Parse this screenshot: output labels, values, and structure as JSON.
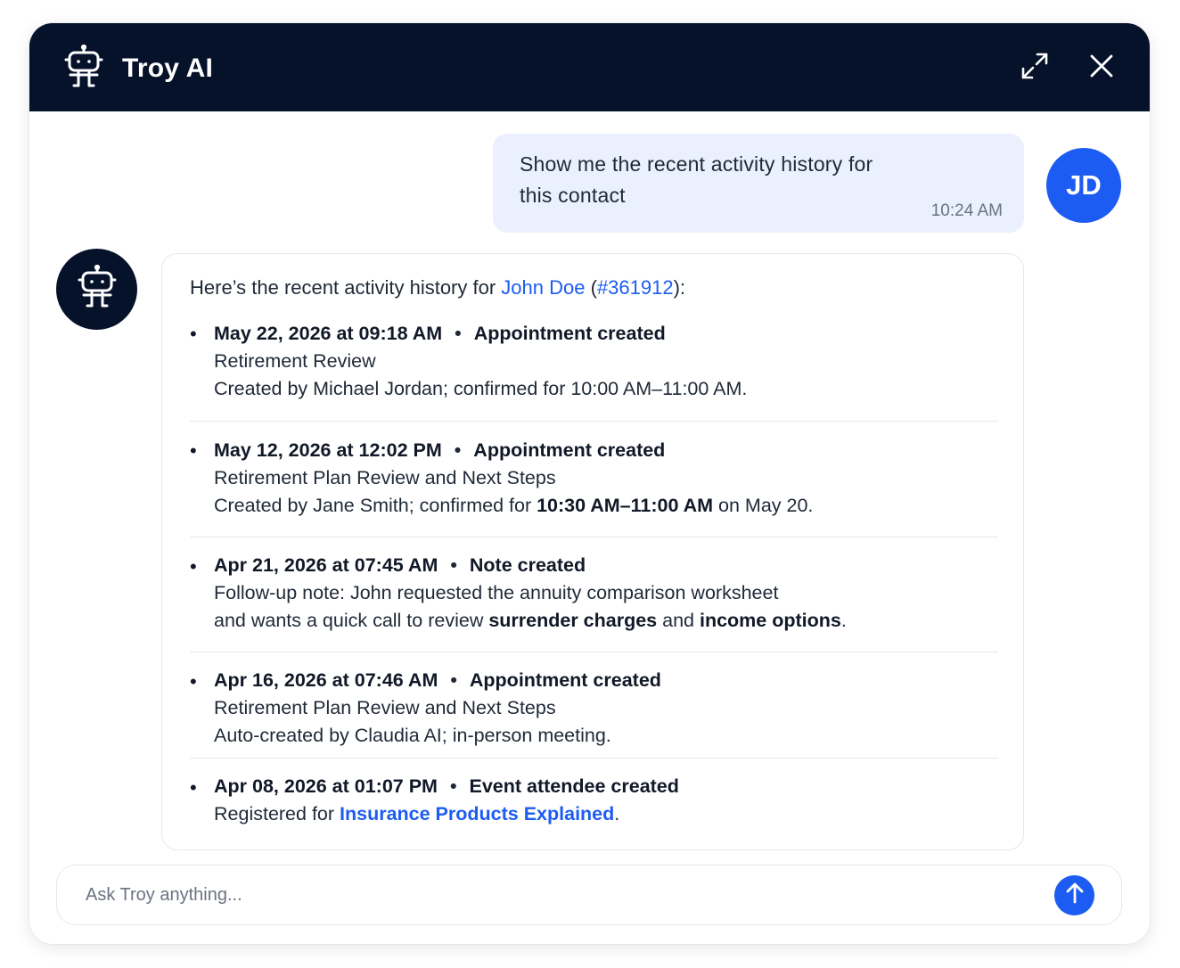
{
  "header": {
    "title": "Troy AI",
    "logo_icon": "robot-icon",
    "expand_icon": "expand-icon",
    "close_icon": "close-icon",
    "background": "#06112a"
  },
  "user_message": {
    "text": "Show me the recent activity history for this contact",
    "time": "10:24 AM",
    "avatar_initials": "JD",
    "avatar_color": "#1d5cf2"
  },
  "bot_message": {
    "intro_prefix": "Here’s the recent activity history for ",
    "contact_name": "John Doe",
    "intro_open": " (",
    "contact_id": "#361912",
    "intro_close": "):",
    "separator": "•",
    "activities": [
      {
        "datetime": "May 22, 2026 at 09:18 AM",
        "type": "Appointment created",
        "title": "Retirement Review",
        "detail": "Created by Michael Jordan; confirmed for 10:00 AM–11:00 AM."
      },
      {
        "datetime": "May 12, 2026 at 12:02 PM",
        "type": "Appointment created",
        "title": "Retirement Plan Review and Next Steps",
        "detail_prefix": "Created by Jane Smith; confirmed for ",
        "detail_bold": "10:30 AM–11:00 AM",
        "detail_suffix": " on May 20."
      },
      {
        "datetime": "Apr 21, 2026 at 07:45 AM",
        "type": "Note created",
        "line1": "Follow-up note: John requested the annuity comparison worksheet",
        "line2_prefix": "and wants a quick call to review ",
        "line2_bold1": "surrender charges",
        "line2_mid": " and ",
        "line2_bold2": "income options",
        "line2_suffix": "."
      },
      {
        "datetime": "Apr 16, 2026 at 07:46 AM",
        "type": "Appointment created",
        "title": "Retirement Plan Review and Next Steps",
        "detail": "Auto-created by Claudia AI; in-person meeting."
      },
      {
        "datetime": "Apr 08, 2026 at 01:07 PM",
        "type": "Event attendee created",
        "detail_prefix": "Registered for ",
        "event_link": "Insurance Products Explained",
        "detail_suffix": "."
      }
    ]
  },
  "input": {
    "placeholder": "Ask Troy anything...",
    "value": "",
    "send_icon": "arrow-up-icon"
  },
  "colors": {
    "accent": "#1d5cf2",
    "user_bubble": "#eaf0fd",
    "border": "#e5e7eb"
  }
}
